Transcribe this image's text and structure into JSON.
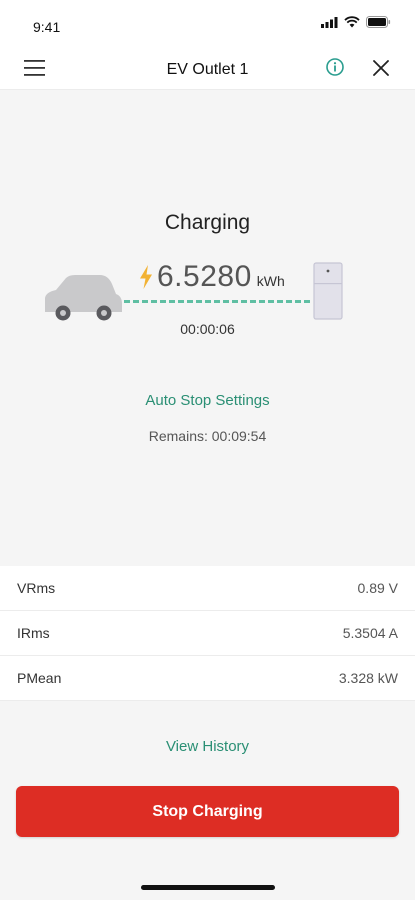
{
  "status_bar": {
    "time": "9:41"
  },
  "header": {
    "title": "EV Outlet 1"
  },
  "session": {
    "status": "Charging",
    "energy_value": "6.5280",
    "energy_unit": "kWh",
    "elapsed": "00:00:06",
    "auto_stop_label": "Auto Stop Settings",
    "remains": "Remains: 00:09:54"
  },
  "metrics": [
    {
      "label": "VRms",
      "value": "0.89 V"
    },
    {
      "label": "IRms",
      "value": "5.3504 A"
    },
    {
      "label": "PMean",
      "value": "3.328 kW"
    }
  ],
  "actions": {
    "view_history": "View History",
    "stop_charging": "Stop Charging"
  },
  "colors": {
    "accent": "#2a8f74",
    "cable": "#5fbfa3",
    "stop_button": "#dd2d24",
    "bolt": "#f2b233"
  }
}
